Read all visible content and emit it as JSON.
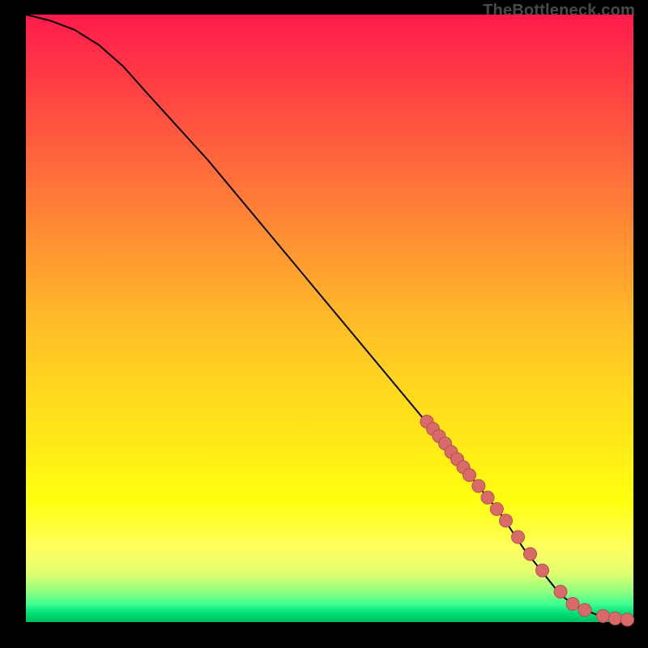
{
  "watermark": "TheBottleneck.com",
  "colors": {
    "point_fill": "#d86a6a",
    "point_stroke": "#b94f4f",
    "curve": "#000000"
  },
  "chart_data": {
    "type": "line",
    "title": "",
    "xlabel": "",
    "ylabel": "",
    "xlim": [
      0,
      100
    ],
    "ylim": [
      0,
      100
    ],
    "grid": false,
    "curve": {
      "name": "bottleneck-curve",
      "x": [
        0,
        4,
        8,
        12,
        16,
        20,
        30,
        40,
        50,
        60,
        70,
        78,
        82,
        86,
        88,
        90,
        92,
        94,
        96,
        98,
        100
      ],
      "y": [
        100,
        99,
        97.5,
        95,
        91.5,
        87,
        76,
        64,
        52,
        40,
        28,
        18,
        12,
        7,
        4.5,
        3,
        2,
        1.2,
        0.7,
        0.4,
        0.3
      ]
    },
    "series": [
      {
        "name": "highlighted-points",
        "type": "scatter",
        "x": [
          66,
          67,
          68,
          69,
          70,
          71,
          72,
          73,
          74.5,
          76,
          77.5,
          79,
          81,
          83,
          85,
          88,
          90,
          92,
          95,
          97,
          99
        ],
        "y": [
          33,
          31.8,
          30.6,
          29.4,
          28,
          26.8,
          25.5,
          24.2,
          22.4,
          20.5,
          18.6,
          16.7,
          14,
          11.2,
          8.5,
          5,
          3,
          2,
          1,
          0.6,
          0.4
        ]
      }
    ]
  }
}
